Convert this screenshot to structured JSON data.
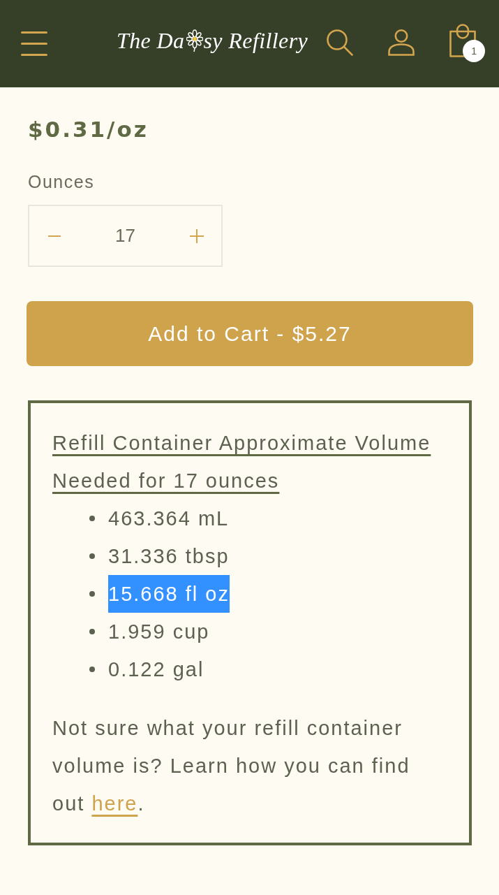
{
  "header": {
    "logo": {
      "text_start": "The Da",
      "text_end": "sy Refillery"
    },
    "cart_count": "1"
  },
  "product": {
    "price": "$0.31/oz",
    "quantity_label": "Ounces",
    "quantity": "17",
    "add_to_cart": "Add to Cart - $5.27"
  },
  "volume_box": {
    "heading": "Refill Container Approximate Volume Needed for 17 ounces",
    "volumes": [
      {
        "text": "463.364 mL",
        "selected": false
      },
      {
        "text": "31.336 tbsp",
        "selected": false
      },
      {
        "text": "15.668 fl oz",
        "selected": true
      },
      {
        "text": "1.959 cup",
        "selected": false
      },
      {
        "text": "0.122 gal",
        "selected": false
      }
    ],
    "note": {
      "text": "Not sure what your refill container volume is? Learn how you can find out ",
      "link": "here",
      "text_end": "."
    }
  }
}
